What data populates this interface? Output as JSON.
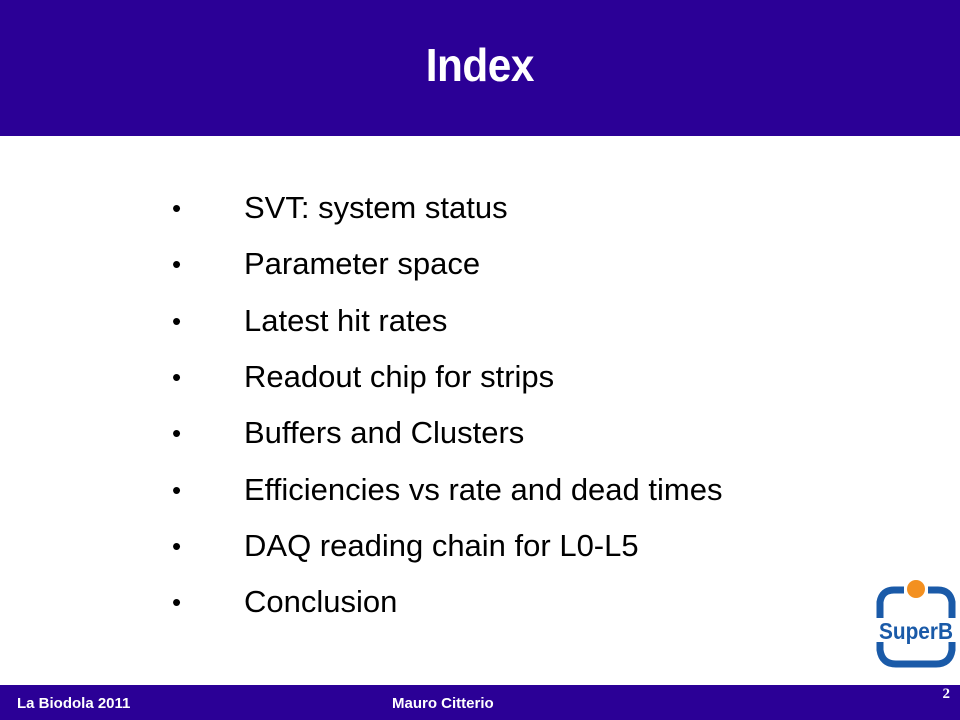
{
  "header": {
    "title": "Index"
  },
  "bullets": [
    {
      "marker": "•",
      "text": "SVT: system status"
    },
    {
      "marker": "•",
      "text": "Parameter space"
    },
    {
      "marker": "•",
      "text": "Latest hit rates"
    },
    {
      "marker": "•",
      "text": "Readout chip for strips"
    },
    {
      "marker": "•",
      "text": "Buffers and Clusters"
    },
    {
      "marker": "•",
      "text": "Efficiencies vs rate and dead times"
    },
    {
      "marker": "•",
      "text": "DAQ reading chain for L0-L5"
    },
    {
      "marker": "•",
      "text": "Conclusion"
    }
  ],
  "logo": {
    "text": "SuperB",
    "name": "superb-logo",
    "colors": {
      "primary": "#1a5aa8",
      "accent": "#f39020"
    }
  },
  "footer": {
    "event": "La Biodola 2011",
    "author": "Mauro Citterio",
    "page_number": "2"
  },
  "colors": {
    "bar": "#2b0096",
    "title_text": "#ffffff",
    "body_text": "#000000"
  }
}
